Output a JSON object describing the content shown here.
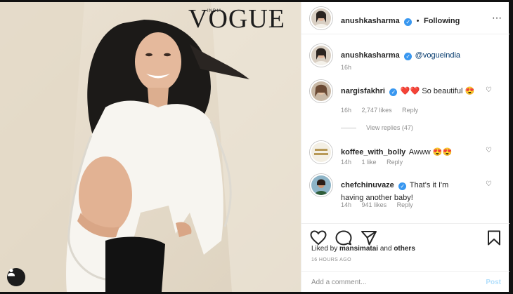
{
  "photo": {
    "magazine_logo": "VOGUE",
    "magazine_edition": "INDIA",
    "user_tag_icon": "user-icon"
  },
  "header": {
    "username": "anushkasharma",
    "verified_icon": "verified-badge-icon",
    "separator": "•",
    "follow_status": "Following",
    "more_icon": "ellipsis-icon"
  },
  "caption": {
    "username": "anushkasharma",
    "mention": "@vogueindia",
    "age": "16h"
  },
  "comments": [
    {
      "username": "nargisfakhri",
      "verified": true,
      "text": "❤️❤️ So beautiful 😍",
      "age": "16h",
      "likes": "2,747 likes",
      "reply": "Reply",
      "view_replies": "View replies (47)"
    },
    {
      "username": "koffee_with_bolly",
      "verified": false,
      "text": "Awww 😍😍",
      "age": "14h",
      "likes": "1 like",
      "reply": "Reply"
    },
    {
      "username": "chefchinuvaze",
      "verified": true,
      "text_line1": "That's it I'm",
      "text_line2": "having another baby!",
      "age": "14h",
      "likes": "941 likes",
      "reply": "Reply"
    }
  ],
  "actions": {
    "like_icon": "heart-icon",
    "comment_icon": "comment-icon",
    "share_icon": "share-icon",
    "save_icon": "bookmark-icon",
    "liked_by_prefix": "Liked by",
    "liked_by_user": "mansimatai",
    "liked_by_and": "and",
    "liked_by_others": "others",
    "timestamp": "16 HOURS AGO"
  },
  "add_comment": {
    "placeholder": "Add a comment...",
    "post_label": "Post"
  },
  "colors": {
    "link_blue": "#3897f0",
    "post_disabled": "#b2dffc",
    "muted": "#8e8e8e",
    "heart_red": "#ed4956"
  }
}
